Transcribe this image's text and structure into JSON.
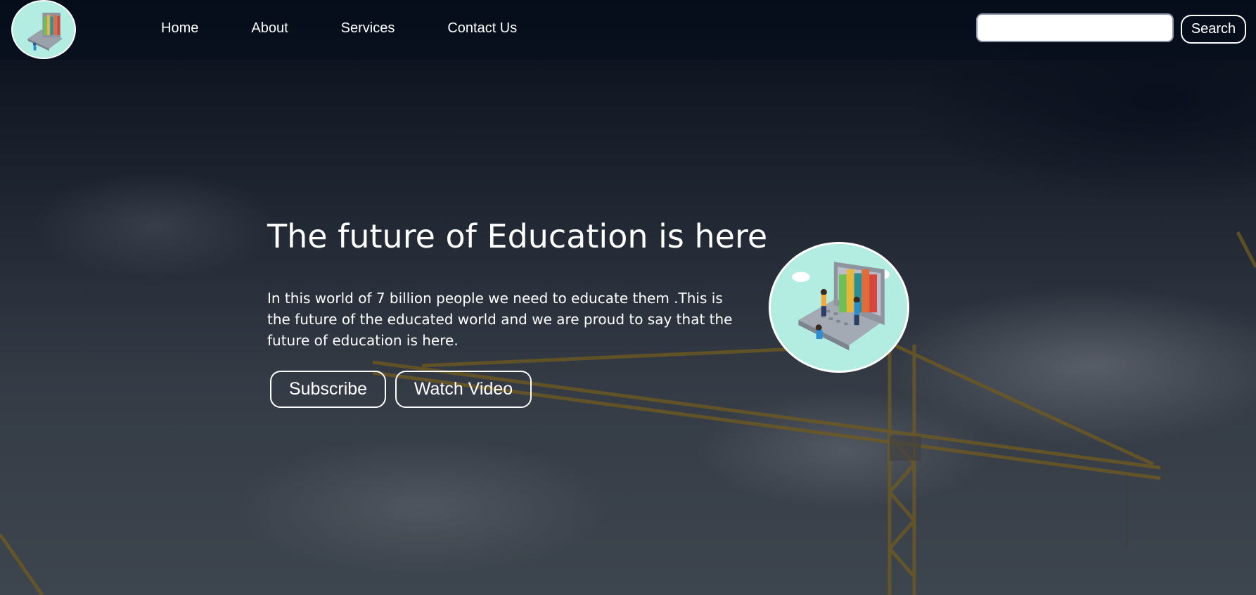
{
  "nav": {
    "links": [
      "Home",
      "About",
      "Services",
      "Contact Us"
    ],
    "search_placeholder": "",
    "search_button": "Search"
  },
  "hero": {
    "title": "The future of Education is here",
    "text": "In this world of 7 billion people we need to educate them .This is the future of the educated world and we are proud to say that the future of education is here.",
    "subscribe_button": "Subscribe",
    "watch_button": "Watch Video"
  },
  "colors": {
    "illustration_bg": "#b3ece0",
    "nav_bg": "rgba(5,12,28,0.55)",
    "text": "#ffffff"
  },
  "icons": {
    "logo": "education-laptop-books-illustration",
    "hero_image": "education-laptop-books-illustration"
  }
}
